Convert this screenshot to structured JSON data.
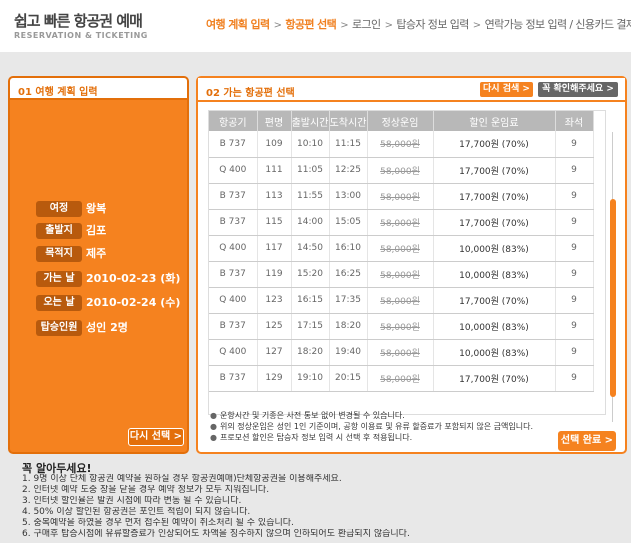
{
  "header": {
    "title": "쉽고 빠른 항공권 예매",
    "subtitle": "RESERVATION & TICKETING",
    "steps": [
      {
        "label": "여행 계획 입력",
        "active": true
      },
      {
        "label": "항공편 선택",
        "active": true
      },
      {
        "label": "로그인",
        "active": false
      },
      {
        "label": "탑승자 정보 입력",
        "active": false
      },
      {
        "label": "연락가능 정보 입력 / 신용카드 결제",
        "active": false
      }
    ],
    "sep": ">"
  },
  "left_panel": {
    "title": "01 여행 계획 입력",
    "info": [
      {
        "label": "여정",
        "value": "왕복"
      },
      {
        "label": "출발지",
        "value": "김포"
      },
      {
        "label": "목적지",
        "value": "제주"
      },
      {
        "label": "가는 날",
        "value": "2010-02-23 (화)"
      },
      {
        "label": "오는 날",
        "value": "2010-02-24 (수)"
      },
      {
        "label": "탑승인원",
        "value": "성인 2명"
      }
    ],
    "reselect_label": "다시 선택 >"
  },
  "right_panel": {
    "title": "02 가는 항공편 선택",
    "research_label": "다시 검색 >",
    "check_label": "꼭 확인해주세요 >",
    "columns": [
      "항공기",
      "편명",
      "출발시간",
      "도착시간",
      "정상운임",
      "할인 운임료",
      "좌석"
    ],
    "rows": [
      [
        "B 737",
        "109",
        "10:10",
        "11:15",
        "58,000원",
        "17,700원 (70%)",
        "9"
      ],
      [
        "Q 400",
        "111",
        "11:05",
        "12:25",
        "58,000원",
        "17,700원 (70%)",
        "9"
      ],
      [
        "B 737",
        "113",
        "11:55",
        "13:00",
        "58,000원",
        "17,700원 (70%)",
        "9"
      ],
      [
        "B 737",
        "115",
        "14:00",
        "15:05",
        "58,000원",
        "17,700원 (70%)",
        "9"
      ],
      [
        "Q 400",
        "117",
        "14:50",
        "16:10",
        "58,000원",
        "10,000원 (83%)",
        "9"
      ],
      [
        "B 737",
        "119",
        "15:20",
        "16:25",
        "58,000원",
        "10,000원 (83%)",
        "9"
      ],
      [
        "Q 400",
        "123",
        "16:15",
        "17:35",
        "58,000원",
        "17,700원 (70%)",
        "9"
      ],
      [
        "B 737",
        "125",
        "17:15",
        "18:20",
        "58,000원",
        "10,000원 (83%)",
        "9"
      ],
      [
        "Q 400",
        "127",
        "18:20",
        "19:40",
        "58,000원",
        "10,000원 (83%)",
        "9"
      ],
      [
        "B 737",
        "129",
        "19:10",
        "20:15",
        "58,000원",
        "17,700원 (70%)",
        "9"
      ]
    ],
    "notes": [
      "운항시간 및 기종은 사전 통보 없이 변경될 수 있습니다.",
      "위의 정상운임은 성인 1인 기준이며, 공항 이용료 및 유류 할증료가 포함되지 않은 금액입니다.",
      "프로모션 할인은 탑승자 정보 입력 시 선택 후 적용됩니다."
    ],
    "done_label": "선택 완료 >",
    "scroll_position": 0.4
  },
  "must_know": {
    "title": "꼭 알아두세요!",
    "items": [
      "1. 9명 이상 단체 항공권 예약을 원하실 경우 항공권예매)단체항공권을 이용해주세요.",
      "2. 인터넷 예약 도중 창을 닫을 경우 예약 정보가 모두 지워집니다.",
      "3. 인터넷 할인율은 발권 시점에 따라 변동 될 수 있습니다.",
      "4. 50% 이상 할인된 항공권은 포인트 적립이 되지 않습니다.",
      "5. 중복예약을 하였을 경우 먼저 접수된 예약이 취소처리 될 수 있습니다.",
      "6. 구매후 탑승시점에 유류할증료가 인상되어도 차액을 징수하지 않으며 인하되어도 환급되지 않습니다."
    ]
  }
}
